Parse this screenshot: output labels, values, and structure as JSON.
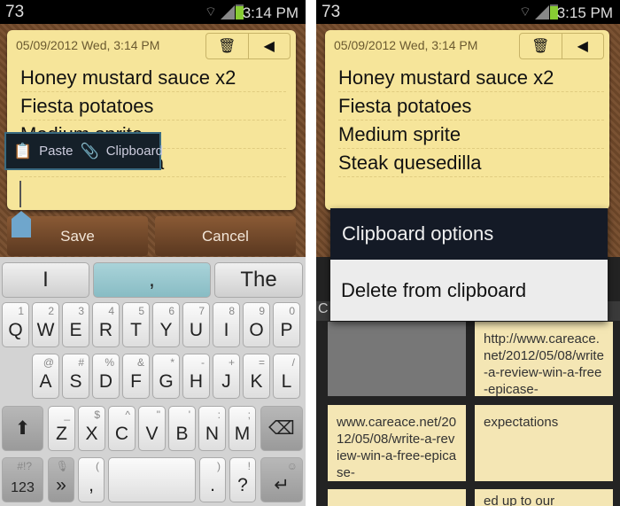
{
  "left": {
    "status": {
      "notifications": "73",
      "time": "3:14 PM"
    },
    "note": {
      "date": "05/09/2012 Wed, 3:14 PM",
      "lines": [
        "Honey mustard sauce x2",
        "Fiesta potatoes",
        "Medium sprite",
        "Steak quesedilla"
      ]
    },
    "popup": {
      "paste": "Paste",
      "clipboard": "Clipboard"
    },
    "buttons": {
      "save": "Save",
      "cancel": "Cancel"
    },
    "keyboard": {
      "suggestions": [
        "I",
        ",",
        "The"
      ],
      "rows": [
        [
          [
            "Q",
            "1"
          ],
          [
            "W",
            "2"
          ],
          [
            "E",
            "3"
          ],
          [
            "R",
            "4"
          ],
          [
            "T",
            "5"
          ],
          [
            "Y",
            "6"
          ],
          [
            "U",
            "7"
          ],
          [
            "I",
            "8"
          ],
          [
            "O",
            "9"
          ],
          [
            "P",
            "0"
          ]
        ],
        [
          [
            "A",
            "@"
          ],
          [
            "S",
            "#"
          ],
          [
            "D",
            "%"
          ],
          [
            "F",
            "&"
          ],
          [
            "G",
            "*"
          ],
          [
            "H",
            "-"
          ],
          [
            "J",
            "+"
          ],
          [
            "K",
            "="
          ],
          [
            "L",
            "/"
          ]
        ],
        [
          [
            "Z",
            "_"
          ],
          [
            "X",
            "$"
          ],
          [
            "C",
            "^"
          ],
          [
            "V",
            "\""
          ],
          [
            "B",
            "'"
          ],
          [
            "N",
            ":"
          ],
          [
            "M",
            ";"
          ]
        ]
      ],
      "bottom": {
        "sym_top": "#!?",
        "sym": "123",
        "comma": ",",
        "comma_sub": "(",
        "period": ".",
        "period_sub": ")",
        "question": "?",
        "question_sub": "!"
      }
    }
  },
  "right": {
    "status": {
      "notifications": "73",
      "time": "3:15 PM"
    },
    "note": {
      "date": "05/09/2012 Wed, 3:14 PM",
      "lines": [
        "Honey mustard sauce x2",
        "Fiesta potatoes",
        "Medium sprite",
        "Steak quesedilla"
      ]
    },
    "dialog": {
      "title": "Clipboard options",
      "option": "Delete from clipboard"
    },
    "clips": [
      "http://www.careace.net/2012/05/08/write-a-review-win-a-free-epicase-",
      "www.careace.net/2012/05/08/write-a-review-win-a-free-epicase-",
      "expectations",
      "",
      "ed up to our"
    ]
  }
}
